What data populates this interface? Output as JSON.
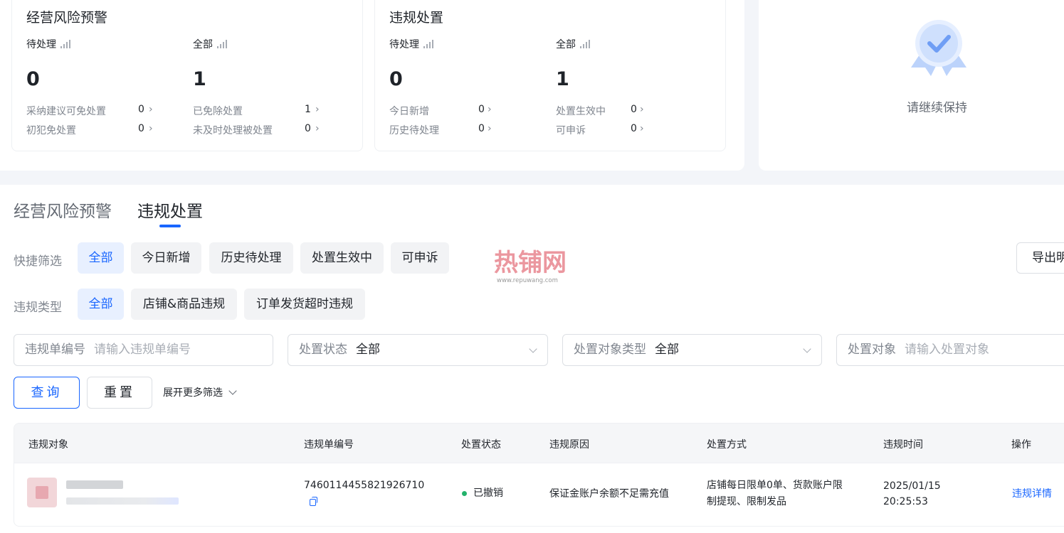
{
  "cards": {
    "risk": {
      "title": "经营风险预警",
      "pending_label": "待处理",
      "pending_value": "0",
      "all_label": "全部",
      "all_value": "1",
      "stats": [
        {
          "label": "采纳建议可免处置",
          "value": "0"
        },
        {
          "label": "初犯免处置",
          "value": "0"
        },
        {
          "label": "已免除处置",
          "value": "1"
        },
        {
          "label": "未及时处理被处置",
          "value": "0"
        }
      ]
    },
    "violation": {
      "title": "违规处置",
      "pending_label": "待处理",
      "pending_value": "0",
      "all_label": "全部",
      "all_value": "1",
      "stats": [
        {
          "label": "今日新增",
          "value": "0"
        },
        {
          "label": "历史待处理",
          "value": "0"
        },
        {
          "label": "处置生效中",
          "value": "0"
        },
        {
          "label": "可申诉",
          "value": "0"
        }
      ]
    },
    "keep": {
      "text": "请继续保持"
    }
  },
  "tabs": [
    {
      "label": "经营风险预警",
      "active": false
    },
    {
      "label": "违规处置",
      "active": true
    }
  ],
  "filters": {
    "quick_label": "快捷筛选",
    "quick_chips": [
      "全部",
      "今日新增",
      "历史待处理",
      "处置生效中",
      "可申诉"
    ],
    "type_label": "违规类型",
    "type_chips": [
      "全部",
      "店铺&商品违规",
      "订单发货超时违规"
    ],
    "export_label": "导出明"
  },
  "watermark": {
    "text": "热铺网",
    "url": "www.repuwang.com"
  },
  "search": {
    "order_no_label": "违规单编号",
    "order_no_placeholder": "请输入违规单编号",
    "status_label": "处置状态",
    "status_value": "全部",
    "object_type_label": "处置对象类型",
    "object_type_value": "全部",
    "object_label": "处置对象",
    "object_placeholder": "请输入处置对象"
  },
  "actions": {
    "query": "查询",
    "reset": "重置",
    "expand": "展开更多筛选"
  },
  "table": {
    "headers": [
      "违规对象",
      "违规单编号",
      "处置状态",
      "违规原因",
      "处置方式",
      "违规时间",
      "操作"
    ],
    "rows": [
      {
        "order_no": "7460114455821926710",
        "status": "已撤销",
        "reason": "保证金账户余额不足需充值",
        "method_line1": "店铺每日限单0单、货款账户限",
        "method_line2": "制提现、限制发品",
        "date": "2025/01/15",
        "time": "20:25:53",
        "action": "违规详情"
      }
    ]
  },
  "colors": {
    "accent": "#1966ff",
    "success": "#23b26b",
    "muted": "#80868f"
  }
}
